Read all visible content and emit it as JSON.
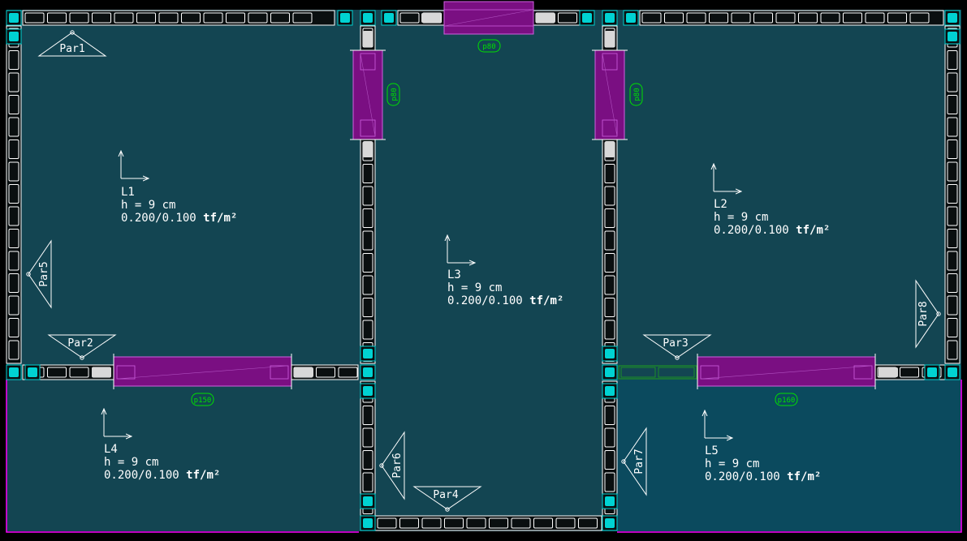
{
  "colors": {
    "background": "#000000",
    "slab": "#134552",
    "slab_alt": "#0b4a5e",
    "block_outline": "#ffffff",
    "joint": "#00d2d2",
    "opening": "#7a0f82",
    "opening_edge": "#d060e0",
    "opening_tag": "#00e000",
    "boundary": "#ff00ff",
    "text": "#ffffff"
  },
  "slabs": [
    {
      "id": "L1",
      "name": "L1",
      "thickness": "h = 9 cm",
      "load_value": "0.200/0.100",
      "load_unit": "tf/m²"
    },
    {
      "id": "L2",
      "name": "L2",
      "thickness": "h = 9 cm",
      "load_value": "0.200/0.100",
      "load_unit": "tf/m²"
    },
    {
      "id": "L3",
      "name": "L3",
      "thickness": "h = 9 cm",
      "load_value": "0.200/0.100",
      "load_unit": "tf/m²"
    },
    {
      "id": "L4",
      "name": "L4",
      "thickness": "h = 9 cm",
      "load_value": "0.200/0.100",
      "load_unit": "tf/m²"
    },
    {
      "id": "L5",
      "name": "L5",
      "thickness": "h = 9 cm",
      "load_value": "0.200/0.100",
      "load_unit": "tf/m²"
    }
  ],
  "walls": [
    {
      "id": "Par1",
      "name": "Par1"
    },
    {
      "id": "Par2",
      "name": "Par2"
    },
    {
      "id": "Par3",
      "name": "Par3"
    },
    {
      "id": "Par4",
      "name": "Par4"
    },
    {
      "id": "Par5",
      "name": "Par5"
    },
    {
      "id": "Par6",
      "name": "Par6"
    },
    {
      "id": "Par7",
      "name": "Par7"
    },
    {
      "id": "Par8",
      "name": "Par8"
    }
  ],
  "openings": [
    {
      "id": "top",
      "tag": "p80"
    },
    {
      "id": "left-door",
      "tag": "p80"
    },
    {
      "id": "right-door",
      "tag": "p80"
    },
    {
      "id": "bottom-left",
      "tag": "p150"
    },
    {
      "id": "bottom-right",
      "tag": "p160"
    }
  ]
}
